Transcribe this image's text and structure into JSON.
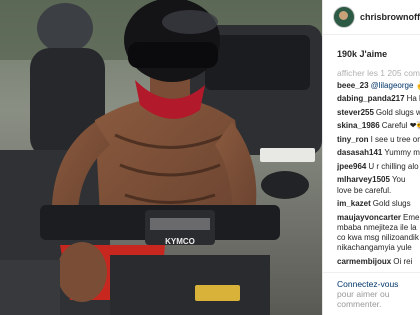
{
  "post": {
    "username": "chrisbrownofficial",
    "likes": "190k J'aime",
    "more_comments": "afficher les 1 205 comm..."
  },
  "photo": {
    "description_icon": "photo-image",
    "plate_text": "KYMCO"
  },
  "comments": [
    {
      "user": "beee_23",
      "text": "@lilageorge",
      "mention": true,
      "tail": " ✌"
    },
    {
      "user": "dabing_panda217",
      "text": "Ha ha"
    },
    {
      "user": "stever255",
      "text": "Gold slugs w"
    },
    {
      "user": "skina_1986",
      "text": "Careful ❤🐝"
    },
    {
      "user": "tiny_ron",
      "text": "I see u tree on"
    },
    {
      "user": "dasasah141",
      "text": "Yummy mis"
    },
    {
      "user": "jpee964",
      "text": "U r chilling alo"
    },
    {
      "user": "mlharvey1505",
      "text": "You love be careful."
    },
    {
      "user": "im_kazet",
      "text": "Gold slugs"
    },
    {
      "user": "maujayvoncarter",
      "text": "Emema mbaba nmejiteza ile la co kwa msg nilizoandik nikachangamyia yule"
    },
    {
      "user": "carmembijoux",
      "text": "Oi rei"
    }
  ],
  "footer": {
    "link": "Connectez-vous",
    "text": "pour aimer ou commenter."
  }
}
